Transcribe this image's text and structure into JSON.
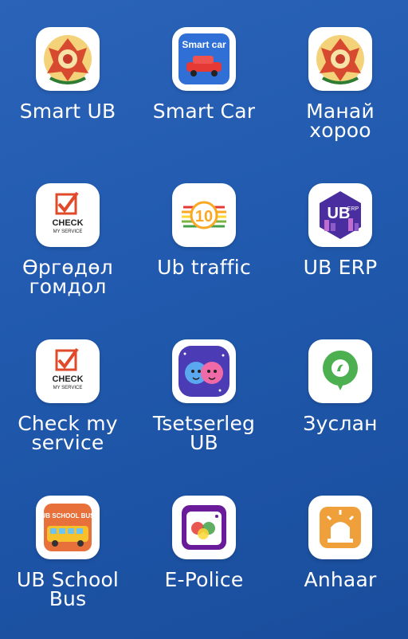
{
  "apps": [
    {
      "label": "Smart UB",
      "icon": "ub-emblem-icon"
    },
    {
      "label": "Smart Car",
      "icon": "smart-car-icon",
      "icon_text": "Smart car"
    },
    {
      "label": "Манай\nхороо",
      "icon": "ub-emblem-icon"
    },
    {
      "label": "Өргөдөл\nгомдол",
      "icon": "check-my-service-icon",
      "icon_text": "CHECK",
      "icon_subtext": "MY SERVICE"
    },
    {
      "label": "Ub traffic",
      "icon": "ub-traffic-icon",
      "icon_text": "10"
    },
    {
      "label": "UB ERP",
      "icon": "ub-erp-icon",
      "icon_text": "UB",
      "icon_subtext": "ERP"
    },
    {
      "label": "Check my\nservice",
      "icon": "check-my-service-icon",
      "icon_text": "CHECK",
      "icon_subtext": "MY SERVICE"
    },
    {
      "label": "Tsetserleg\nUB",
      "icon": "kids-faces-icon"
    },
    {
      "label": "Зуслан",
      "icon": "map-pin-icon"
    },
    {
      "label": "UB School\nBus",
      "icon": "school-bus-icon",
      "icon_text": "UB SCHOOL BUS"
    },
    {
      "label": "E-Police",
      "icon": "camera-icon"
    },
    {
      "label": "Anhaar",
      "icon": "alarm-siren-icon"
    }
  ],
  "colors": {
    "background": "#2059ad",
    "icon_bg": "#ffffff",
    "check_red": "#e04a2a",
    "pin_green": "#4caf50",
    "police_purple": "#6a1b9a",
    "alarm_orange": "#f0a03a"
  }
}
